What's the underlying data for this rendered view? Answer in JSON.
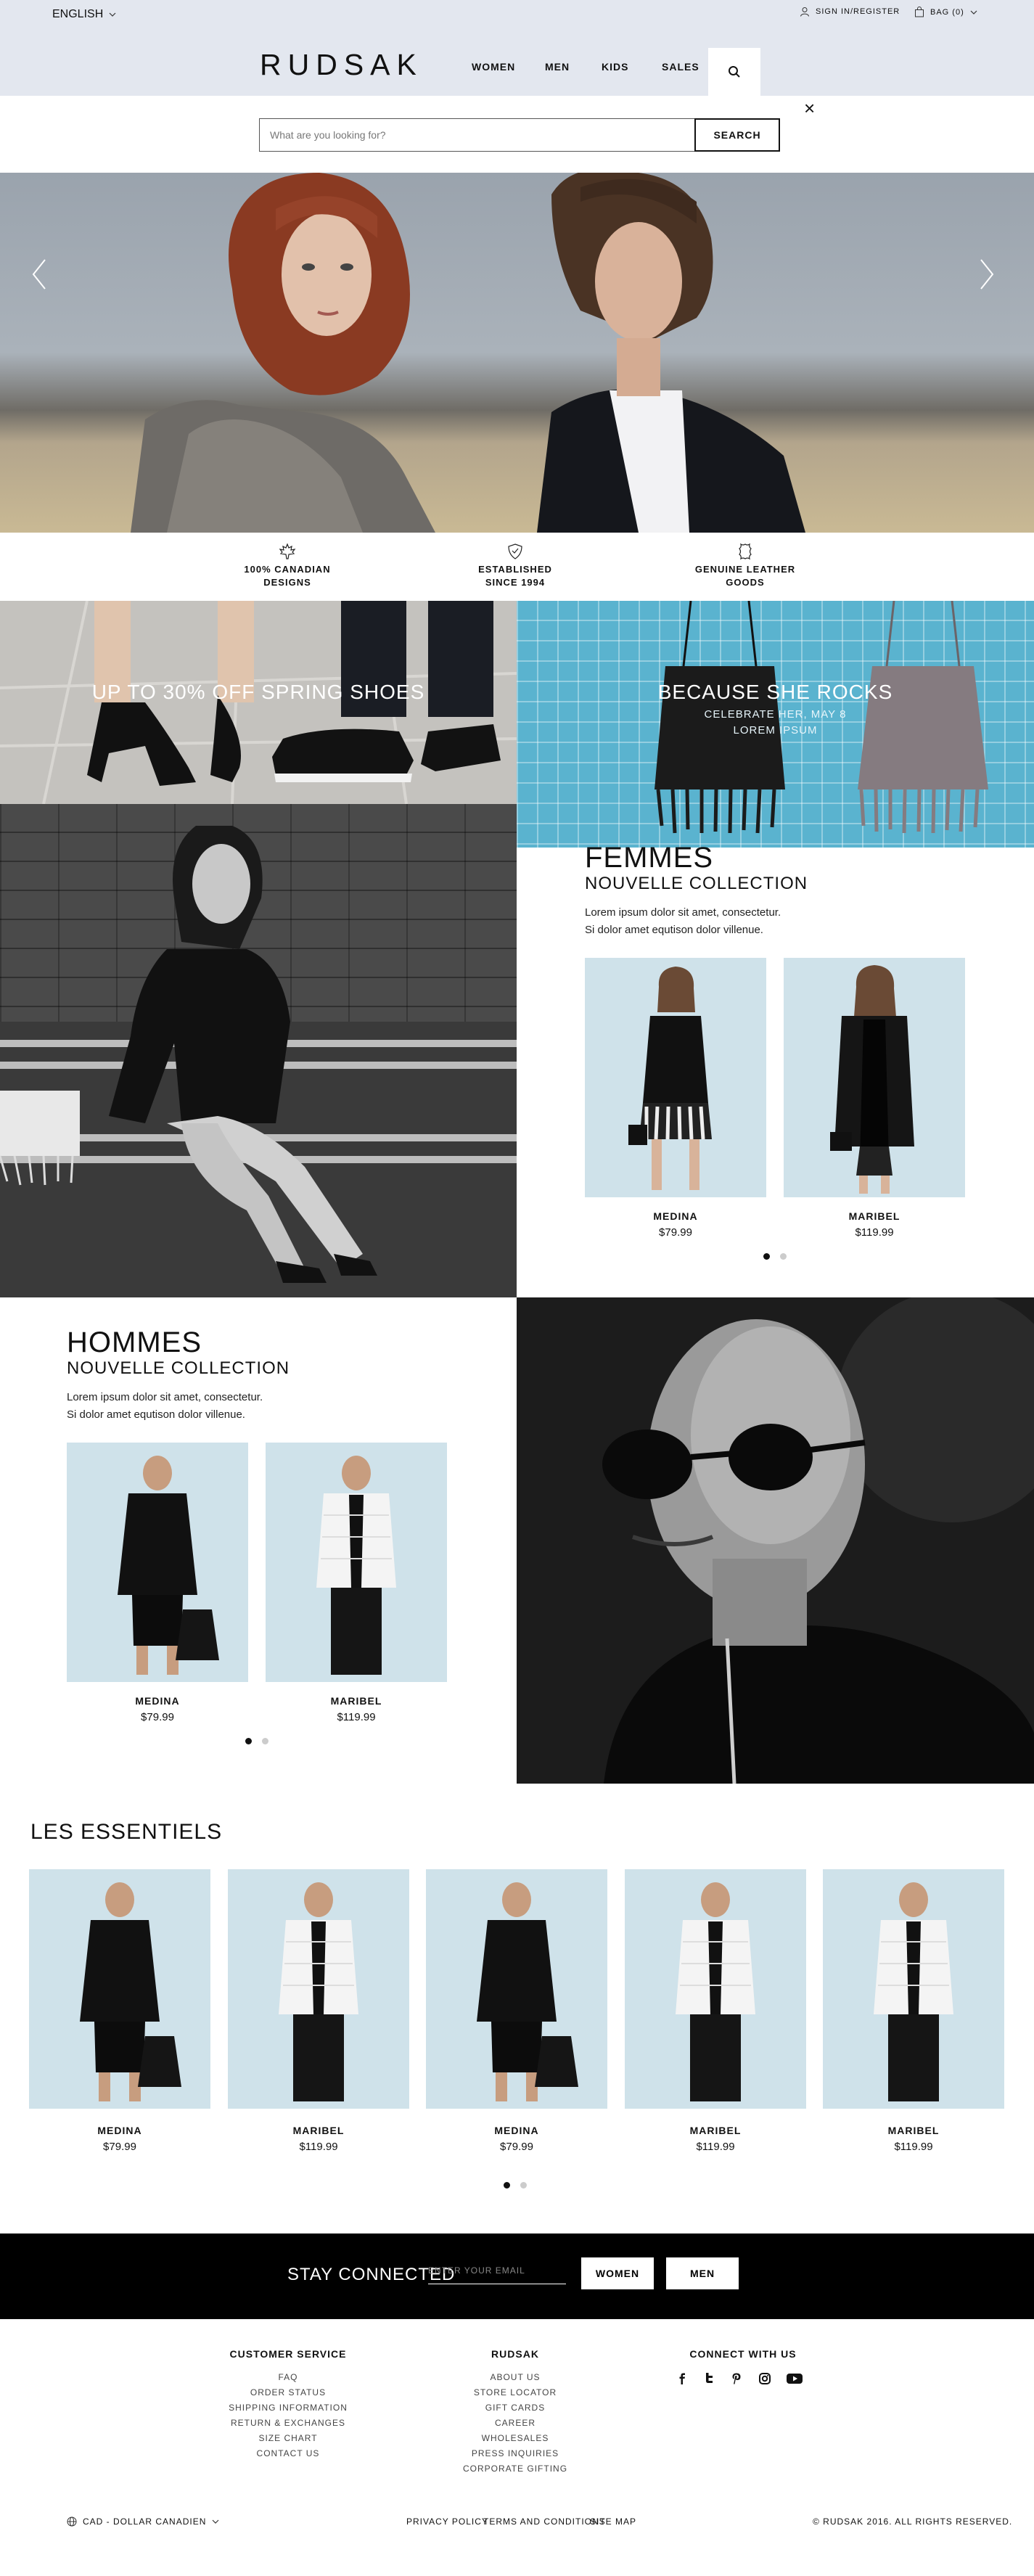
{
  "topbar": {
    "language": "ENGLISH",
    "account": "SIGN IN/REGISTER",
    "bag": "BAG (0)"
  },
  "header": {
    "logo": "RUDSAK",
    "nav": [
      "WOMEN",
      "MEN",
      "KIDS",
      "SALES"
    ]
  },
  "search": {
    "placeholder": "What are you looking for?",
    "button": "SEARCH"
  },
  "features": [
    {
      "icon": "maple-leaf-icon",
      "line1": "100% CANADIAN",
      "line2": "DESIGNS"
    },
    {
      "icon": "shield-icon",
      "line1": "ESTABLISHED",
      "line2": "SINCE 1994"
    },
    {
      "icon": "leather-hide-icon",
      "line1": "GENUINE LEATHER",
      "line2": "GOODS"
    }
  ],
  "promos": {
    "shoes": {
      "title": "UP TO 30% OFF SPRING SHOES"
    },
    "bags": {
      "title": "BECAUSE SHE ROCKS",
      "line1": "CELEBRATE HER, MAY 8",
      "line2": "LOREM IPSUM"
    }
  },
  "femmes": {
    "title": "FEMMES",
    "subtitle": "NOUVELLE COLLECTION",
    "text1": "Lorem ipsum dolor sit amet, consectetur.",
    "text2": "Si dolor amet equtison dolor villenue.",
    "products": [
      {
        "name": "MEDINA",
        "price": "$79.99"
      },
      {
        "name": "MARIBEL",
        "price": "$119.99"
      }
    ]
  },
  "hommes": {
    "title": "HOMMES",
    "subtitle": "NOUVELLE COLLECTION",
    "text1": "Lorem ipsum dolor sit amet, consectetur.",
    "text2": "Si dolor amet equtison dolor villenue.",
    "products": [
      {
        "name": "MEDINA",
        "price": "$79.99"
      },
      {
        "name": "MARIBEL",
        "price": "$119.99"
      }
    ]
  },
  "essentials": {
    "title": "LES ESSENTIELS",
    "products": [
      {
        "name": "MEDINA",
        "price": "$79.99"
      },
      {
        "name": "MARIBEL",
        "price": "$119.99"
      },
      {
        "name": "MEDINA",
        "price": "$79.99"
      },
      {
        "name": "MARIBEL",
        "price": "$119.99"
      },
      {
        "name": "MARIBEL",
        "price": "$119.99"
      }
    ]
  },
  "newsletter": {
    "label": "STAY CONNECTED",
    "placeholder": "ENTER YOUR EMAIL",
    "women": "WOMEN",
    "men": "MEN"
  },
  "footer": {
    "customer_service": {
      "title": "CUSTOMER SERVICE",
      "links": [
        "FAQ",
        "ORDER STATUS",
        "SHIPPING INFORMATION",
        "RETURN & EXCHANGES",
        "SIZE CHART",
        "CONTACT US"
      ]
    },
    "rudsak": {
      "title": "RUDSAK",
      "links": [
        "ABOUT US",
        "STORE LOCATOR",
        "GIFT CARDS",
        "CAREER",
        "WHOLESALES",
        "PRESS INQUIRIES",
        "CORPORATE GIFTING"
      ]
    },
    "connect": {
      "title": "CONNECT WITH US",
      "icons": [
        "facebook-icon",
        "twitter-icon",
        "pinterest-icon",
        "instagram-icon",
        "youtube-icon"
      ]
    },
    "currency": "CAD - DOLLAR CANADIEN",
    "legal": [
      "PRIVACY POLICY",
      "TERMS AND CONDITIONS",
      "SITE MAP"
    ],
    "copyright": "© RUDSAK 2016. ALL RIGHTS RESERVED."
  },
  "colors": {
    "header_bg": "#e3e7ef",
    "accent": "#000000",
    "product_bg": "#cfe2ea"
  }
}
